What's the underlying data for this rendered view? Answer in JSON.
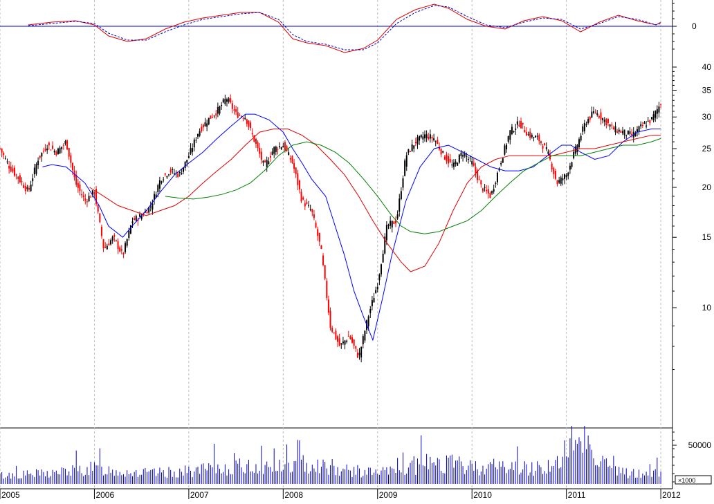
{
  "chart_data": [
    {
      "panel": "oscillator",
      "type": "line",
      "y_ticks": [
        0
      ],
      "series": [
        {
          "style": "solid",
          "color": "#e00000",
          "x": [
            2005.3,
            2005.55,
            2005.8,
            2006.0,
            2006.15,
            2006.35,
            2006.55,
            2006.75,
            2006.95,
            2007.15,
            2007.35,
            2007.55,
            2007.75,
            2007.95,
            2008.1,
            2008.25,
            2008.45,
            2008.65,
            2008.85,
            2009.0,
            2009.2,
            2009.4,
            2009.6,
            2009.75,
            2009.95,
            2010.15,
            2010.35,
            2010.55,
            2010.75,
            2010.95,
            2011.15,
            2011.35,
            2011.55,
            2011.75,
            2011.95,
            2012.0
          ],
          "y": [
            0.05,
            0.15,
            0.2,
            0.05,
            -0.35,
            -0.55,
            -0.45,
            -0.1,
            0.15,
            0.3,
            0.4,
            0.5,
            0.5,
            0.15,
            -0.45,
            -0.6,
            -0.7,
            -0.95,
            -0.8,
            -0.5,
            0.25,
            0.6,
            0.8,
            0.65,
            0.25,
            0.0,
            -0.1,
            0.2,
            0.35,
            0.2,
            -0.2,
            0.15,
            0.4,
            0.2,
            0.05,
            0.15
          ]
        },
        {
          "style": "dashed",
          "color": "#0000c0",
          "x": [
            2005.3,
            2005.55,
            2005.8,
            2006.0,
            2006.15,
            2006.35,
            2006.55,
            2006.75,
            2006.95,
            2007.15,
            2007.35,
            2007.55,
            2007.75,
            2007.95,
            2008.1,
            2008.25,
            2008.45,
            2008.65,
            2008.85,
            2009.0,
            2009.2,
            2009.4,
            2009.6,
            2009.75,
            2009.95,
            2010.15,
            2010.35,
            2010.55,
            2010.75,
            2010.95,
            2011.15,
            2011.35,
            2011.55,
            2011.75,
            2011.95,
            2012.0
          ],
          "y": [
            0.02,
            0.1,
            0.18,
            0.1,
            -0.25,
            -0.5,
            -0.5,
            -0.2,
            0.05,
            0.25,
            0.35,
            0.45,
            0.5,
            0.25,
            -0.3,
            -0.55,
            -0.65,
            -0.85,
            -0.85,
            -0.6,
            0.1,
            0.5,
            0.75,
            0.7,
            0.35,
            0.05,
            -0.05,
            0.15,
            0.3,
            0.25,
            -0.1,
            0.1,
            0.35,
            0.25,
            0.05,
            0.1
          ]
        }
      ]
    },
    {
      "panel": "price",
      "type": "candlestick",
      "y_scale": "log",
      "y_ticks": [
        10,
        15,
        20,
        25,
        30,
        35,
        40
      ],
      "ylim": [
        6.2,
        42
      ],
      "close": {
        "x": [
          2005.0,
          2005.1,
          2005.2,
          2005.3,
          2005.4,
          2005.5,
          2005.6,
          2005.7,
          2005.8,
          2005.9,
          2006.0,
          2006.1,
          2006.2,
          2006.3,
          2006.4,
          2006.5,
          2006.6,
          2006.7,
          2006.8,
          2006.9,
          2007.0,
          2007.1,
          2007.2,
          2007.3,
          2007.4,
          2007.5,
          2007.6,
          2007.7,
          2007.8,
          2007.9,
          2008.0,
          2008.1,
          2008.2,
          2008.3,
          2008.4,
          2008.5,
          2008.6,
          2008.7,
          2008.8,
          2008.9,
          2009.0,
          2009.1,
          2009.2,
          2009.3,
          2009.4,
          2009.5,
          2009.6,
          2009.7,
          2009.8,
          2009.9,
          2010.0,
          2010.1,
          2010.2,
          2010.3,
          2010.4,
          2010.5,
          2010.6,
          2010.7,
          2010.8,
          2010.9,
          2011.0,
          2011.1,
          2011.2,
          2011.3,
          2011.4,
          2011.5,
          2011.6,
          2011.7,
          2011.8,
          2011.9,
          2012.0
        ],
        "y": [
          25.0,
          22.5,
          21.0,
          19.5,
          23.5,
          25.5,
          24.5,
          26.0,
          20.5,
          18.5,
          19.5,
          14.0,
          15.0,
          13.5,
          16.5,
          17.0,
          18.0,
          21.0,
          22.0,
          21.5,
          24.0,
          27.5,
          29.5,
          31.0,
          33.5,
          30.5,
          30.0,
          26.0,
          22.5,
          25.0,
          25.5,
          23.0,
          18.5,
          17.5,
          14.0,
          9.0,
          8.0,
          8.5,
          7.5,
          9.5,
          11.5,
          16.0,
          16.5,
          24.0,
          26.0,
          27.0,
          26.5,
          24.0,
          22.5,
          24.5,
          23.0,
          20.0,
          19.0,
          23.0,
          27.5,
          29.0,
          27.0,
          26.5,
          24.5,
          20.5,
          21.5,
          25.0,
          29.0,
          31.0,
          29.5,
          28.0,
          27.5,
          27.0,
          28.5,
          29.5,
          32.5
        ]
      },
      "series": [
        {
          "name_visible": false,
          "color": "#0000ff",
          "x": [
            2005.45,
            2005.55,
            2005.7,
            2005.9,
            2006.05,
            2006.15,
            2006.3,
            2006.4,
            2006.55,
            2006.7,
            2006.85,
            2007.0,
            2007.15,
            2007.3,
            2007.45,
            2007.6,
            2007.7,
            2007.85,
            2008.0,
            2008.1,
            2008.2,
            2008.3,
            2008.45,
            2008.55,
            2008.65,
            2008.75,
            2008.85,
            2008.95,
            2009.05,
            2009.15,
            2009.3,
            2009.45,
            2009.6,
            2009.75,
            2009.9,
            2010.05,
            2010.2,
            2010.35,
            2010.5,
            2010.65,
            2010.8,
            2010.95,
            2011.05,
            2011.15,
            2011.3,
            2011.45,
            2011.6,
            2011.75,
            2011.9,
            2012.0
          ],
          "y": [
            22.5,
            22.8,
            22.5,
            20.5,
            18.0,
            16.0,
            15.0,
            16.0,
            17.5,
            19.5,
            21.5,
            23.0,
            24.5,
            26.5,
            28.5,
            30.5,
            30.5,
            29.5,
            27.5,
            25.0,
            23.0,
            21.0,
            19.0,
            16.0,
            13.5,
            11.0,
            9.5,
            8.3,
            10.5,
            13.5,
            18.5,
            22.5,
            25.0,
            25.5,
            24.5,
            23.5,
            22.5,
            22.0,
            22.0,
            22.5,
            24.0,
            25.5,
            25.5,
            24.5,
            23.5,
            24.0,
            26.0,
            27.5,
            28.0,
            28.0
          ]
        },
        {
          "name_visible": false,
          "color": "#e00000",
          "x": [
            2005.95,
            2006.1,
            2006.25,
            2006.4,
            2006.55,
            2006.7,
            2006.85,
            2007.0,
            2007.15,
            2007.3,
            2007.45,
            2007.6,
            2007.75,
            2007.9,
            2008.05,
            2008.2,
            2008.35,
            2008.5,
            2008.65,
            2008.8,
            2008.95,
            2009.1,
            2009.25,
            2009.35,
            2009.5,
            2009.65,
            2009.8,
            2009.95,
            2010.1,
            2010.25,
            2010.4,
            2010.55,
            2010.7,
            2010.85,
            2011.0,
            2011.15,
            2011.3,
            2011.45,
            2011.6,
            2011.75,
            2011.9,
            2012.0
          ],
          "y": [
            20.0,
            19.0,
            18.0,
            17.5,
            17.0,
            17.5,
            18.0,
            19.0,
            20.5,
            22.0,
            23.5,
            25.5,
            27.5,
            28.0,
            28.0,
            27.0,
            25.5,
            23.5,
            21.5,
            19.0,
            16.5,
            14.5,
            13.0,
            12.3,
            12.7,
            14.5,
            17.5,
            20.5,
            22.5,
            23.5,
            24.0,
            24.0,
            24.0,
            24.0,
            24.5,
            25.0,
            25.0,
            25.5,
            26.0,
            26.5,
            27.0,
            27.0
          ]
        },
        {
          "name_visible": false,
          "color": "#008000",
          "x": [
            2006.75,
            2006.9,
            2007.05,
            2007.2,
            2007.35,
            2007.5,
            2007.65,
            2007.8,
            2007.95,
            2008.1,
            2008.25,
            2008.4,
            2008.55,
            2008.7,
            2008.85,
            2009.0,
            2009.15,
            2009.25,
            2009.35,
            2009.5,
            2009.65,
            2009.8,
            2009.95,
            2010.1,
            2010.25,
            2010.4,
            2010.55,
            2010.7,
            2010.85,
            2011.0,
            2011.15,
            2011.3,
            2011.45,
            2011.6,
            2011.75,
            2011.9,
            2012.0
          ],
          "y": [
            19.0,
            18.8,
            18.7,
            18.9,
            19.2,
            19.7,
            20.5,
            22.0,
            24.0,
            25.5,
            26.0,
            25.5,
            24.5,
            23.0,
            21.0,
            19.0,
            17.0,
            16.0,
            15.5,
            15.3,
            15.5,
            16.0,
            16.5,
            17.5,
            19.0,
            20.5,
            22.0,
            23.0,
            24.0,
            24.0,
            24.0,
            24.5,
            25.0,
            25.5,
            25.5,
            26.0,
            26.5
          ]
        }
      ]
    },
    {
      "panel": "volume",
      "type": "bar",
      "y_ticks": [
        50000
      ],
      "unit_label": "×1000",
      "color": "#0000cc",
      "x": [
        2005.0,
        2005.5,
        2006.0,
        2006.3,
        2006.6,
        2007.0,
        2007.3,
        2007.6,
        2008.0,
        2008.3,
        2008.6,
        2009.0,
        2009.3,
        2009.6,
        2010.0,
        2010.3,
        2010.6,
        2011.0,
        2011.1,
        2011.2,
        2011.5,
        2011.8,
        2012.0
      ],
      "values": [
        12000,
        15000,
        22000,
        18000,
        15000,
        18000,
        22000,
        25000,
        24000,
        30000,
        20000,
        16000,
        20000,
        32000,
        24000,
        26000,
        22000,
        30000,
        70000,
        60000,
        18000,
        14000,
        16000
      ]
    }
  ],
  "x_axis": {
    "labels": [
      "2005",
      "2006",
      "2007",
      "2008",
      "2009",
      "2010",
      "2011",
      "2012"
    ],
    "years": [
      2005,
      2006,
      2007,
      2008,
      2009,
      2010,
      2011,
      2012
    ]
  }
}
